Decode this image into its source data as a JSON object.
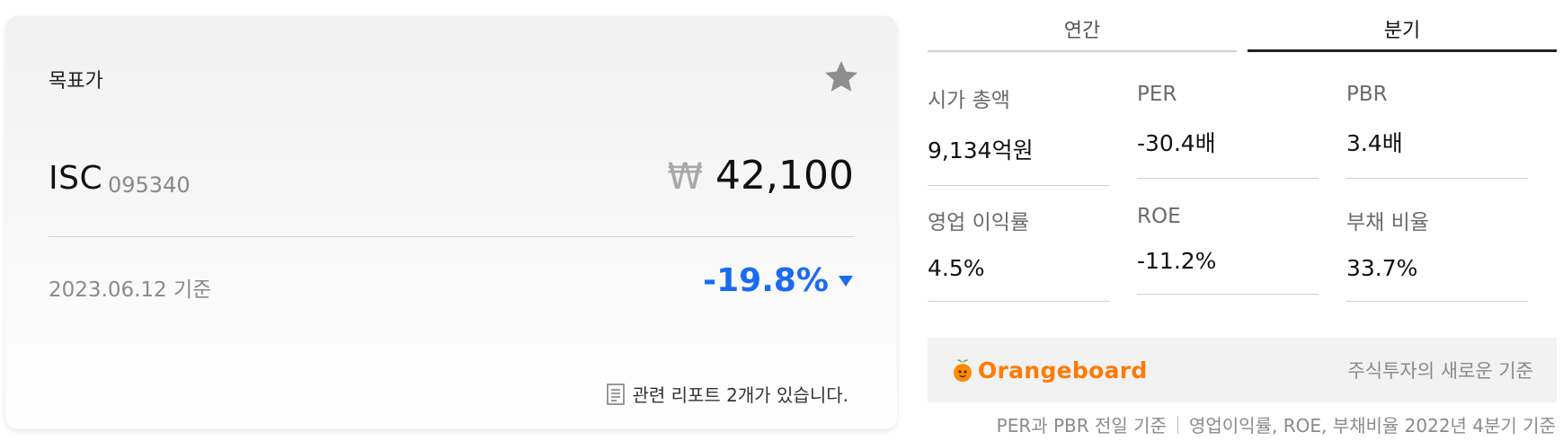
{
  "card": {
    "title": "목표가",
    "stock_name": "ISC",
    "stock_code": "095340",
    "currency_symbol": "₩",
    "price": "42,100",
    "date": "2023.06.12 기준",
    "change": "-19.8%",
    "reports_text": "관련 리포트 2개가 있습니다.",
    "favorite_icon": "star-icon",
    "change_icon": "down-triangle-icon",
    "change_color": "#1a6bf0"
  },
  "tabs": [
    {
      "label": "연간",
      "active": false
    },
    {
      "label": "분기",
      "active": true
    }
  ],
  "metrics": [
    {
      "label": "시가 총액",
      "value": "9,134억원"
    },
    {
      "label": "PER",
      "value": "-30.4배"
    },
    {
      "label": "PBR",
      "value": "3.4배"
    },
    {
      "label": "영업 이익률",
      "value": "4.5%"
    },
    {
      "label": "ROE",
      "value": "-11.2%"
    },
    {
      "label": "부채 비율",
      "value": "33.7%"
    }
  ],
  "banner": {
    "brand": "Orangeboard",
    "tagline": "주식투자의 새로운 기준",
    "brand_color": "#ff7a00"
  },
  "footnote": {
    "left": "PER과 PBR 전일 기준",
    "right": "영업이익률, ROE, 부채비율 2022년 4분기 기준"
  }
}
